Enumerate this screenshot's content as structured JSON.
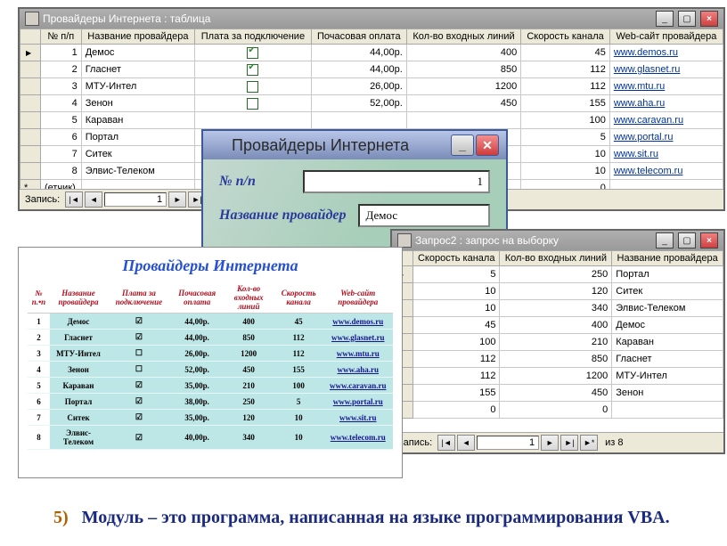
{
  "mainTable": {
    "title": "Провайдеры Интернета : таблица",
    "columns": [
      "№ п/п",
      "Название провайдера",
      "Плата за подключение",
      "Почасовая оплата",
      "Кол-во входных линий",
      "Скорость канала",
      "Web-сайт провайдера"
    ],
    "rows": [
      {
        "n": "1",
        "name": "Демос",
        "fee_on": true,
        "rate": "44,00р.",
        "lines": "400",
        "speed": "45",
        "site": "www.demos.ru"
      },
      {
        "n": "2",
        "name": "Гласнет",
        "fee_on": true,
        "rate": "44,00р.",
        "lines": "850",
        "speed": "112",
        "site": "www.glasnet.ru"
      },
      {
        "n": "3",
        "name": "МТУ-Интел",
        "fee_on": false,
        "rate": "26,00р.",
        "lines": "1200",
        "speed": "112",
        "site": "www.mtu.ru"
      },
      {
        "n": "4",
        "name": "Зенон",
        "fee_on": false,
        "rate": "52,00р.",
        "lines": "450",
        "speed": "155",
        "site": "www.aha.ru"
      },
      {
        "n": "5",
        "name": "Караван",
        "fee_on": null,
        "rate": "",
        "lines": "",
        "speed": "100",
        "site": "www.caravan.ru"
      },
      {
        "n": "6",
        "name": "Портал",
        "fee_on": null,
        "rate": "",
        "lines": "",
        "speed": "5",
        "site": "www.portal.ru"
      },
      {
        "n": "7",
        "name": "Ситек",
        "fee_on": null,
        "rate": "",
        "lines": "",
        "speed": "10",
        "site": "www.sit.ru"
      },
      {
        "n": "8",
        "name": "Элвис-Телеком",
        "fee_on": null,
        "rate": "",
        "lines": "",
        "speed": "10",
        "site": "www.telecom.ru"
      }
    ],
    "newRowLabel": "(етчик)",
    "newRowZero": "0",
    "nav": {
      "label": "Запись:",
      "pos": "1"
    }
  },
  "formDlg": {
    "title": "Провайдеры Интернета",
    "field1": "№ п/п",
    "field1val": "1",
    "field2": "Название провайдер",
    "field2val": "Демос"
  },
  "query": {
    "title": "Запрос2 : запрос на выборку",
    "columns": [
      "Скорость канала",
      "Кол-во входных линий",
      "Название провайдера"
    ],
    "rows": [
      {
        "speed": "5",
        "lines": "250",
        "name": "Портал"
      },
      {
        "speed": "10",
        "lines": "120",
        "name": "Ситек"
      },
      {
        "speed": "10",
        "lines": "340",
        "name": "Элвис-Телеком"
      },
      {
        "speed": "45",
        "lines": "400",
        "name": "Демос"
      },
      {
        "speed": "100",
        "lines": "210",
        "name": "Караван"
      },
      {
        "speed": "112",
        "lines": "850",
        "name": "Гласнет"
      },
      {
        "speed": "112",
        "lines": "1200",
        "name": "МТУ-Интел"
      },
      {
        "speed": "155",
        "lines": "450",
        "name": "Зенон"
      }
    ],
    "zeroRow": {
      "speed": "0",
      "lines": "0",
      "name": ""
    },
    "nav": {
      "label": "Запись:",
      "pos": "1",
      "suffix": "из 8"
    }
  },
  "report": {
    "title": "Провайдеры Интернета",
    "columns": [
      "№ п.•п",
      "Название провайдера",
      "Плата за подключение",
      "Почасовая оплата",
      "Кол-во входных линий",
      "Скорость канала",
      "Web-сайт провайдера"
    ],
    "rows": [
      {
        "n": "1",
        "name": "Демос",
        "fee": "☑",
        "rate": "44,00р.",
        "lines": "400",
        "speed": "45",
        "site": "www.demos.ru"
      },
      {
        "n": "2",
        "name": "Гласнет",
        "fee": "☑",
        "rate": "44,00р.",
        "lines": "850",
        "speed": "112",
        "site": "www.glasnet.ru"
      },
      {
        "n": "3",
        "name": "МТУ-Интел",
        "fee": "☐",
        "rate": "26,00р.",
        "lines": "1200",
        "speed": "112",
        "site": "www.mtu.ru"
      },
      {
        "n": "4",
        "name": "Зенон",
        "fee": "☐",
        "rate": "52,00р.",
        "lines": "450",
        "speed": "155",
        "site": "www.aha.ru"
      },
      {
        "n": "5",
        "name": "Караван",
        "fee": "☑",
        "rate": "35,00р.",
        "lines": "210",
        "speed": "100",
        "site": "www.caravan.ru"
      },
      {
        "n": "6",
        "name": "Портал",
        "fee": "☑",
        "rate": "38,00р.",
        "lines": "250",
        "speed": "5",
        "site": "www.portal.ru"
      },
      {
        "n": "7",
        "name": "Ситек",
        "fee": "☑",
        "rate": "35,00р.",
        "lines": "120",
        "speed": "10",
        "site": "www.sit.ru"
      },
      {
        "n": "8",
        "name": "Элвис-Телеком",
        "fee": "☑",
        "rate": "40,00р.",
        "lines": "340",
        "speed": "10",
        "site": "www.telecom.ru"
      }
    ]
  },
  "footnote": {
    "num": "5)",
    "bold": "Модуль",
    "rest": " – это программа, написанная на языке программирования VBA."
  }
}
